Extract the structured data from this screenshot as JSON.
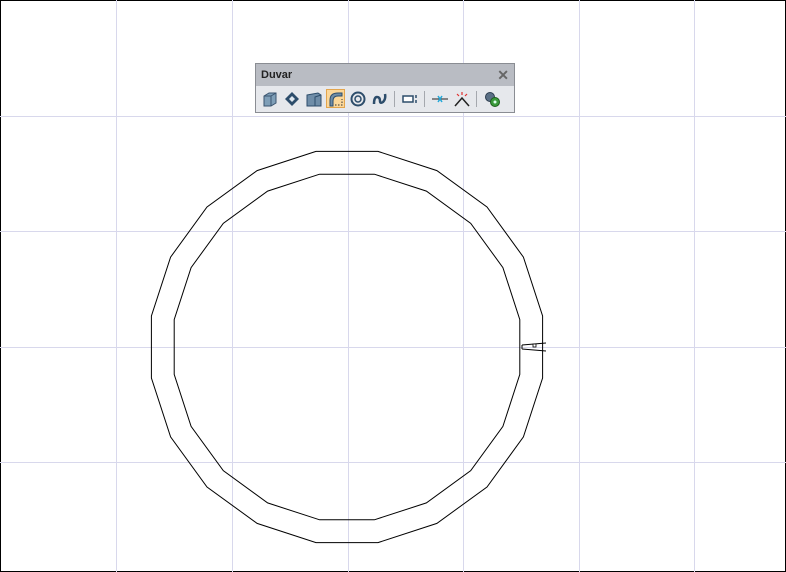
{
  "toolbar": {
    "title": "Duvar",
    "close_label": "✕",
    "tools": [
      {
        "name": "straight-wall",
        "active": false
      },
      {
        "name": "polygon-wall",
        "active": false
      },
      {
        "name": "corner-wall",
        "active": false
      },
      {
        "name": "arc-wall",
        "active": true
      },
      {
        "name": "circle-wall",
        "active": false
      },
      {
        "name": "curve-wall",
        "active": false
      },
      {
        "name": "wall-offset",
        "active": false
      },
      {
        "name": "wall-split",
        "active": false
      },
      {
        "name": "wall-trim",
        "active": false
      },
      {
        "name": "wall-settings",
        "active": false
      }
    ]
  },
  "colors": {
    "grid": "#d8d8ec",
    "wall": "#000000",
    "accent": "#fbd79a"
  }
}
